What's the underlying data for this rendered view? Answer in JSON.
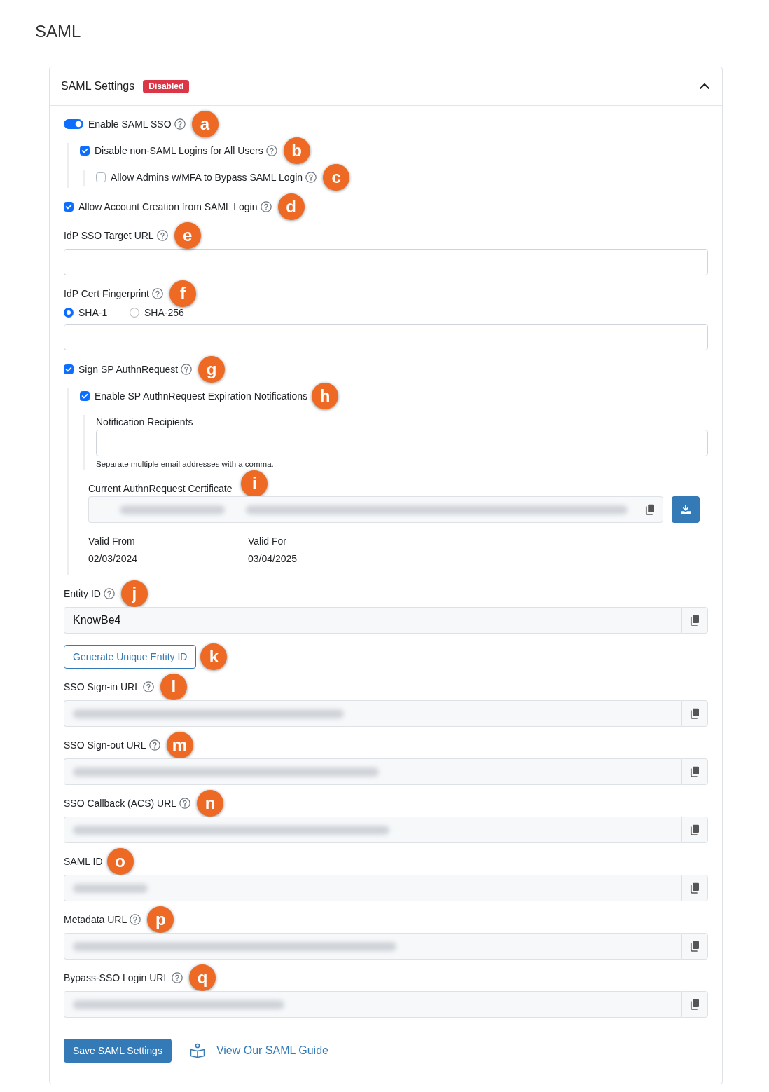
{
  "page": {
    "title": "SAML"
  },
  "card": {
    "title": "SAML Settings",
    "badge": {
      "text": "Disabled",
      "kind": "danger"
    },
    "expanded": true
  },
  "settings": [
    {
      "kind": "toggle",
      "label": "Enable SAML SSO",
      "on": true,
      "help": true,
      "marker": "a",
      "children": [
        {
          "kind": "checkbox",
          "label": "Disable non-SAML Logins for All Users",
          "checked": true,
          "help": true,
          "marker": "b",
          "children": [
            {
              "kind": "checkbox",
              "label": "Allow Admins w/MFA to Bypass SAML Login",
              "checked": false,
              "help": true,
              "marker": "c"
            }
          ]
        }
      ]
    },
    {
      "kind": "checkbox",
      "label": "Allow Account Creation from SAML Login",
      "checked": true,
      "help": true,
      "marker": "d"
    },
    {
      "kind": "input",
      "label": "IdP SSO Target URL",
      "help": true,
      "marker": "e"
    },
    {
      "kind": "radio-input",
      "label": "IdP Cert Fingerprint",
      "help": true,
      "marker": "f",
      "options": [
        {
          "label": "SHA-1",
          "selected": true
        },
        {
          "label": "SHA-256",
          "selected": false
        }
      ]
    },
    {
      "kind": "checkbox",
      "label": "Sign SP AuthnRequest",
      "checked": true,
      "help": true,
      "marker": "g",
      "children": [
        {
          "kind": "checkbox",
          "label": "Enable SP AuthnRequest Expiration Notifications",
          "checked": true,
          "help": false,
          "marker": "h",
          "children": [
            {
              "kind": "input",
              "label": "Notification Recipients",
              "help": false,
              "hint": "Separate multiple email addresses with a comma."
            }
          ]
        },
        {
          "kind": "certificate",
          "label": "Current AuthnRequest Certificate",
          "help": false,
          "marker": "i",
          "blurred": true,
          "dates": [
            {
              "label": "Valid From",
              "value": "02/03/2024"
            },
            {
              "label": "Valid For",
              "value": "03/04/2025"
            }
          ]
        }
      ]
    },
    {
      "kind": "copy-field",
      "label": "Entity ID",
      "help": true,
      "marker": "j",
      "blurred": false,
      "value": "KnowBe4"
    },
    {
      "kind": "button",
      "label": "Generate Unique Entity ID",
      "marker": "k"
    },
    {
      "kind": "copy-field",
      "label": "SSO Sign-in URL",
      "help": true,
      "marker": "l",
      "blurred": true
    },
    {
      "kind": "copy-field",
      "label": "SSO Sign-out URL",
      "help": true,
      "marker": "m",
      "blurred": true
    },
    {
      "kind": "copy-field",
      "label": "SSO Callback (ACS) URL",
      "help": true,
      "marker": "n",
      "blurred": true
    },
    {
      "kind": "copy-field",
      "label": "SAML ID",
      "help": false,
      "marker": "o",
      "blurred": true
    },
    {
      "kind": "copy-field",
      "label": "Metadata URL",
      "help": true,
      "marker": "p",
      "blurred": true
    },
    {
      "kind": "copy-field",
      "label": "Bypass-SSO Login URL",
      "help": true,
      "marker": "q",
      "blurred": true
    }
  ],
  "actions": {
    "save": "Save SAML Settings",
    "guide_link": "View Our SAML Guide"
  }
}
